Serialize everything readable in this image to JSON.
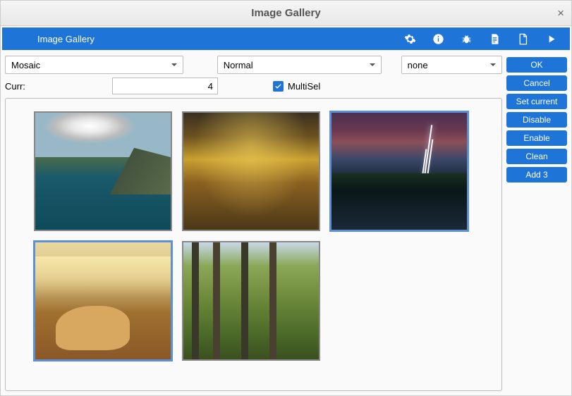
{
  "titlebar": {
    "title": "Image Gallery"
  },
  "toolbar": {
    "title": "Image Gallery"
  },
  "selects": {
    "layout": "Mosaic",
    "mode": "Normal",
    "filter": "none"
  },
  "curr": {
    "label": "Curr:",
    "value": "4"
  },
  "multisel": {
    "label": "MultiSel",
    "checked": true
  },
  "gallery": {
    "thumbs": [
      {
        "name": "lake",
        "selected": false
      },
      {
        "name": "fields",
        "selected": false
      },
      {
        "name": "storm",
        "selected": true
      },
      {
        "name": "cat",
        "selected": true
      },
      {
        "name": "forest",
        "selected": false
      }
    ]
  },
  "buttons": {
    "ok": "OK",
    "cancel": "Cancel",
    "set_current": "Set current",
    "disable": "Disable",
    "enable": "Enable",
    "clean": "Clean",
    "add3": "Add 3"
  }
}
